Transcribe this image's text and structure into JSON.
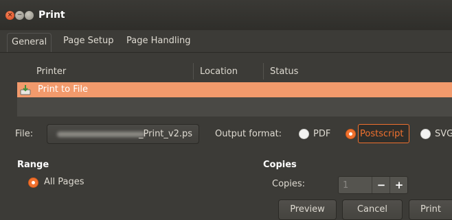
{
  "window": {
    "title": "Print"
  },
  "tabs": [
    {
      "label": "General"
    },
    {
      "label": "Page Setup"
    },
    {
      "label": "Page Handling"
    }
  ],
  "printers": {
    "columns": [
      "Printer",
      "Location",
      "Status"
    ],
    "rows": [
      {
        "name": "Print to File",
        "selected": true
      }
    ]
  },
  "file": {
    "label": "File:",
    "value": "_Print_v2.ps"
  },
  "output_format": {
    "label": "Output format:",
    "options": [
      {
        "label": "PDF",
        "selected": false
      },
      {
        "label": "Postscript",
        "selected": true
      },
      {
        "label": "SVG",
        "selected": false
      }
    ]
  },
  "range": {
    "heading": "Range",
    "options": [
      {
        "label": "All Pages",
        "selected": true
      }
    ]
  },
  "copies": {
    "heading": "Copies",
    "label": "Copies:",
    "value": "1",
    "minus": "−",
    "plus": "+"
  },
  "buttons": {
    "preview": "Preview",
    "cancel": "Cancel",
    "print": "Print"
  },
  "colors": {
    "accent": "#f0712f",
    "selection": "#f29a6c",
    "background": "#3c3b37"
  }
}
